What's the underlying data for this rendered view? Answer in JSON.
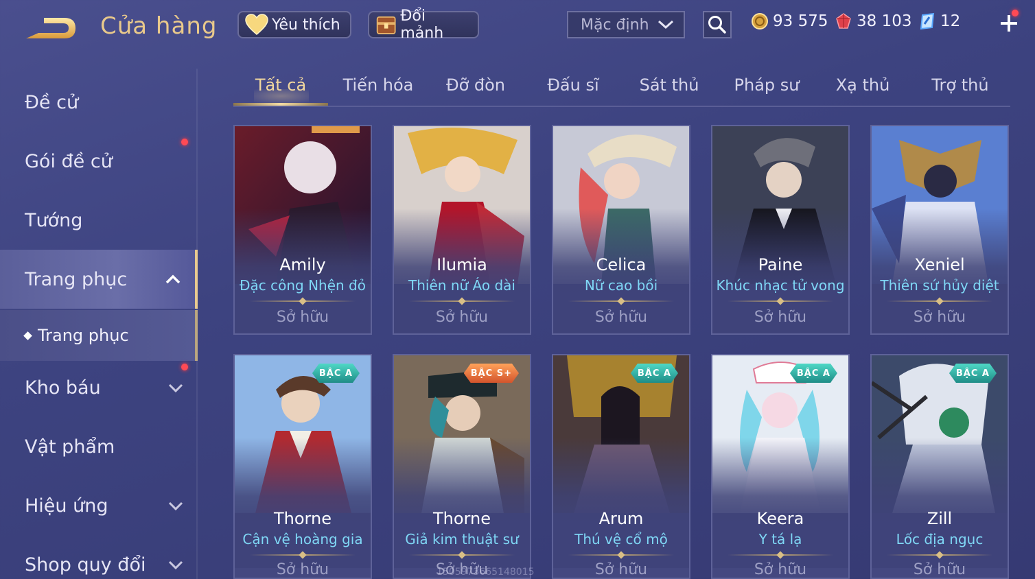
{
  "header": {
    "title": "Cửa hàng",
    "favorites_label": "Yêu thích",
    "exchange_label": "Đổi mảnh",
    "sort_value": "Mặc định",
    "currency": {
      "gold": "93 575",
      "ruby": "38 103",
      "gem": "12"
    }
  },
  "sidebar": {
    "items": [
      {
        "label": "Đề cử"
      },
      {
        "label": "Gói đề cử"
      },
      {
        "label": "Tướng"
      },
      {
        "label": "Trang phục"
      },
      {
        "label": "Trang phục"
      },
      {
        "label": "Kho báu"
      },
      {
        "label": "Vật phẩm"
      },
      {
        "label": "Hiệu ứng"
      },
      {
        "label": "Shop quy đổi"
      }
    ]
  },
  "tabs": [
    {
      "label": "Tất cả"
    },
    {
      "label": "Tiến hóa"
    },
    {
      "label": "Đỡ đòn"
    },
    {
      "label": "Đấu sĩ"
    },
    {
      "label": "Sát thủ"
    },
    {
      "label": "Pháp sư"
    },
    {
      "label": "Xạ thủ"
    },
    {
      "label": "Trợ thủ"
    }
  ],
  "cards": [
    {
      "hero": "Amily",
      "skin": "Đặc công Nhện đỏ",
      "status": "Sở hữu"
    },
    {
      "hero": "Ilumia",
      "skin": "Thiên nữ Áo dài",
      "status": "Sở hữu"
    },
    {
      "hero": "Celica",
      "skin": "Nữ cao bồi",
      "status": "Sở hữu"
    },
    {
      "hero": "Paine",
      "skin": "Khúc nhạc tử vong",
      "status": "Sở hữu"
    },
    {
      "hero": "Xeniel",
      "skin": "Thiên sứ hủy diệt",
      "status": "Sở hữu"
    },
    {
      "hero": "Thorne",
      "skin": "Cận vệ hoàng gia",
      "status": "Sở hữu",
      "badge": "BẬC A"
    },
    {
      "hero": "Thorne",
      "skin": "Giả kim thuật sư",
      "status": "Sở hữu",
      "badge": "BẬC S+"
    },
    {
      "hero": "Arum",
      "skin": "Thú vệ cổ mộ",
      "status": "Sở hữu",
      "badge": "BẬC A"
    },
    {
      "hero": "Keera",
      "skin": "Y tá lạ",
      "status": "Sở hữu",
      "badge": "BẬC A"
    },
    {
      "hero": "Zill",
      "skin": "Lốc địa ngục",
      "status": "Sở hữu",
      "badge": "BẬC A"
    }
  ],
  "watermark": "1505973665148015",
  "colors": {
    "accent_gold": "#e9c98b",
    "skin_text": "#7fd7f5",
    "notification": "#ff4a55"
  }
}
